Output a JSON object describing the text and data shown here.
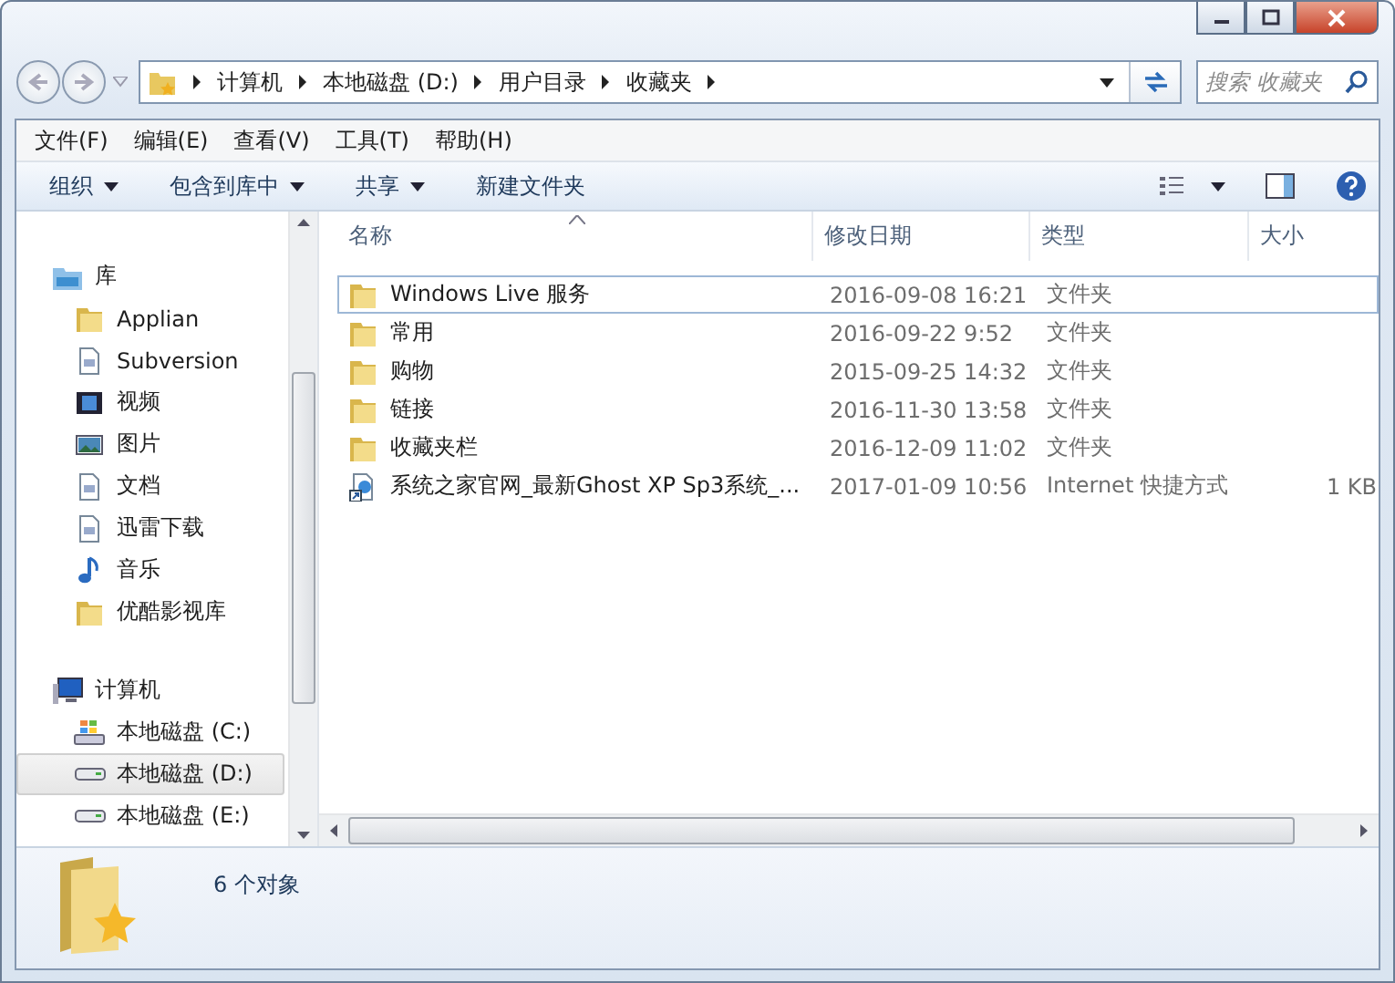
{
  "address": {
    "crumbs": [
      "计算机",
      "本地磁盘 (D:)",
      "用户目录",
      "收藏夹"
    ]
  },
  "search": {
    "placeholder": "搜索 收藏夹"
  },
  "menu": [
    "文件(F)",
    "编辑(E)",
    "查看(V)",
    "工具(T)",
    "帮助(H)"
  ],
  "commands": [
    {
      "label": "组织",
      "dropdown": true
    },
    {
      "label": "包含到库中",
      "dropdown": true
    },
    {
      "label": "共享",
      "dropdown": true
    },
    {
      "label": "新建文件夹",
      "dropdown": false
    }
  ],
  "nav": [
    {
      "label": "库",
      "kind": "library",
      "selected": false,
      "children": [
        {
          "label": "Applian",
          "kind": "folder",
          "selected": false
        },
        {
          "label": "Subversion",
          "kind": "document",
          "selected": false
        },
        {
          "label": "视频",
          "kind": "video",
          "selected": false
        },
        {
          "label": "图片",
          "kind": "picture",
          "selected": false
        },
        {
          "label": "文档",
          "kind": "document",
          "selected": false
        },
        {
          "label": "迅雷下载",
          "kind": "document",
          "selected": false
        },
        {
          "label": "音乐",
          "kind": "music",
          "selected": false
        },
        {
          "label": "优酷影视库",
          "kind": "folder",
          "selected": false
        }
      ]
    },
    {
      "label": "计算机",
      "kind": "computer",
      "selected": false,
      "children": [
        {
          "label": "本地磁盘 (C:)",
          "kind": "system-drive",
          "selected": false
        },
        {
          "label": "本地磁盘 (D:)",
          "kind": "drive",
          "selected": true
        },
        {
          "label": "本地磁盘 (E:)",
          "kind": "drive",
          "selected": false
        }
      ]
    }
  ],
  "table": {
    "columns": [
      "名称",
      "修改日期",
      "类型",
      "大小"
    ],
    "rows": [
      {
        "kind": "folder",
        "name": "Windows Live 服务",
        "date": "2016-09-08 16:21",
        "type": "文件夹",
        "size": "",
        "selected": true
      },
      {
        "kind": "folder",
        "name": "常用",
        "date": "2016-09-22 9:52",
        "type": "文件夹",
        "size": "",
        "selected": false
      },
      {
        "kind": "folder",
        "name": "购物",
        "date": "2015-09-25 14:32",
        "type": "文件夹",
        "size": "",
        "selected": false
      },
      {
        "kind": "folder",
        "name": "链接",
        "date": "2016-11-30 13:58",
        "type": "文件夹",
        "size": "",
        "selected": false
      },
      {
        "kind": "folder",
        "name": "收藏夹栏",
        "date": "2016-12-09 11:02",
        "type": "文件夹",
        "size": "",
        "selected": false
      },
      {
        "kind": "shortcut",
        "name": "系统之家官网_最新Ghost XP Sp3系统_...",
        "date": "2017-01-09 10:56",
        "type": "Internet 快捷方式",
        "size": "1 KB",
        "selected": false
      }
    ]
  },
  "status": {
    "count": "6 个对象"
  }
}
